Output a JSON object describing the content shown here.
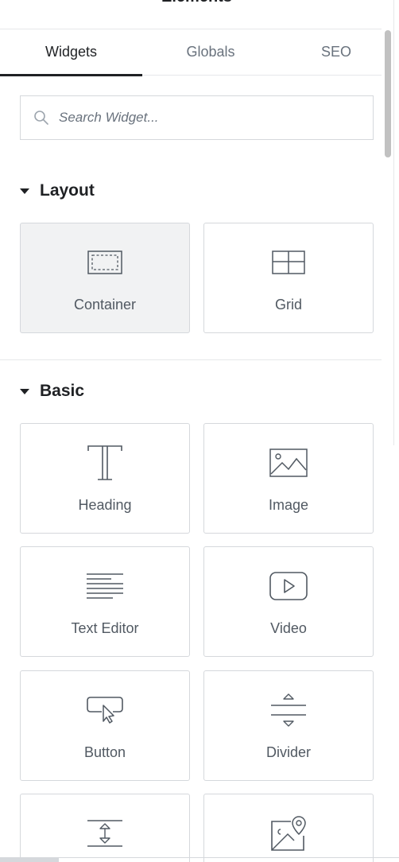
{
  "panel": {
    "title": "Elements"
  },
  "tabs": [
    {
      "label": "Widgets",
      "active": true
    },
    {
      "label": "Globals",
      "active": false
    },
    {
      "label": "SEO",
      "active": false
    }
  ],
  "search": {
    "placeholder": "Search Widget..."
  },
  "sections": {
    "layout": {
      "title": "Layout",
      "widgets": [
        {
          "label": "Container",
          "icon": "container-icon"
        },
        {
          "label": "Grid",
          "icon": "grid-icon"
        }
      ]
    },
    "basic": {
      "title": "Basic",
      "widgets": [
        {
          "label": "Heading",
          "icon": "heading-icon"
        },
        {
          "label": "Image",
          "icon": "image-icon"
        },
        {
          "label": "Text Editor",
          "icon": "text-editor-icon"
        },
        {
          "label": "Video",
          "icon": "video-icon"
        },
        {
          "label": "Button",
          "icon": "button-icon"
        },
        {
          "label": "Divider",
          "icon": "divider-icon"
        },
        {
          "label": "",
          "icon": "spacer-icon"
        },
        {
          "label": "",
          "icon": "google-maps-icon"
        }
      ]
    }
  },
  "colors": {
    "text": "#1f2124",
    "muted": "#69727d",
    "border": "#d5d8dc",
    "hover": "#f1f2f3"
  }
}
